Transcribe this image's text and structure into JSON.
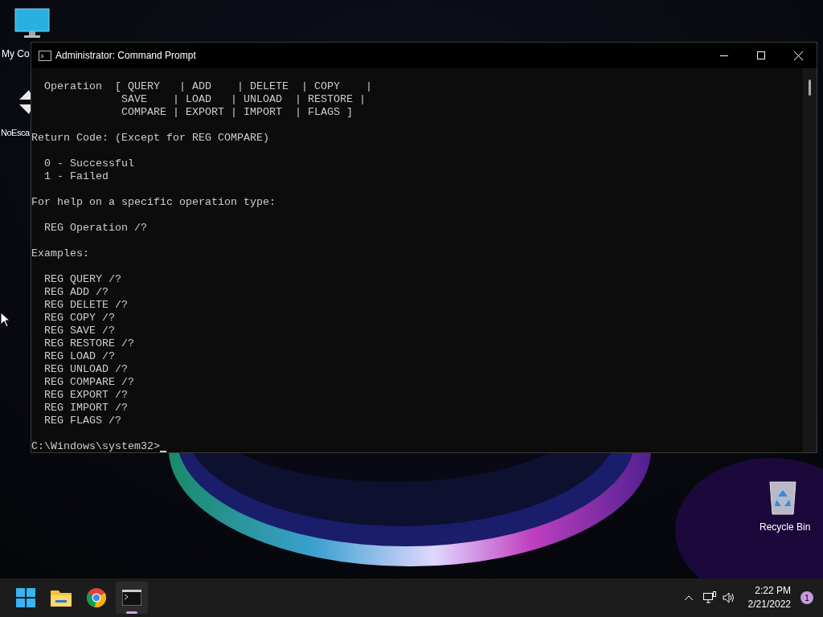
{
  "desktop_icons": [
    {
      "label": "My Co",
      "kind": "computer"
    },
    {
      "label": "NoEsca",
      "kind": "arrows"
    },
    {
      "label": "Recycle Bin",
      "kind": "recycle"
    }
  ],
  "window": {
    "title": "Administrator: Command Prompt",
    "blocks": [
      [
        "  Operation  [ QUERY   | ADD    | DELETE  | COPY    |",
        "              SAVE    | LOAD   | UNLOAD  | RESTORE |",
        "              COMPARE | EXPORT | IMPORT  | FLAGS ]"
      ],
      [
        "Return Code: (Except for REG COMPARE)"
      ],
      [
        "  0 - Successful",
        "  1 - Failed"
      ],
      [
        "For help on a specific operation type:"
      ],
      [
        "  REG Operation /?"
      ],
      [
        "Examples:"
      ],
      [
        "  REG QUERY /?",
        "  REG ADD /?",
        "  REG DELETE /?",
        "  REG COPY /?",
        "  REG SAVE /?",
        "  REG RESTORE /?",
        "  REG LOAD /?",
        "  REG UNLOAD /?",
        "  REG COMPARE /?",
        "  REG EXPORT /?",
        "  REG IMPORT /?",
        "  REG FLAGS /?"
      ]
    ],
    "prompt": "C:\\Windows\\system32>"
  },
  "taskbar": {
    "apps": [
      {
        "kind": "start",
        "selected": false
      },
      {
        "kind": "folder",
        "selected": false
      },
      {
        "kind": "browser",
        "selected": false
      },
      {
        "kind": "terminal",
        "selected": true
      }
    ],
    "time": "2:22 PM",
    "date": "2/21/2022",
    "notifications": "1"
  }
}
